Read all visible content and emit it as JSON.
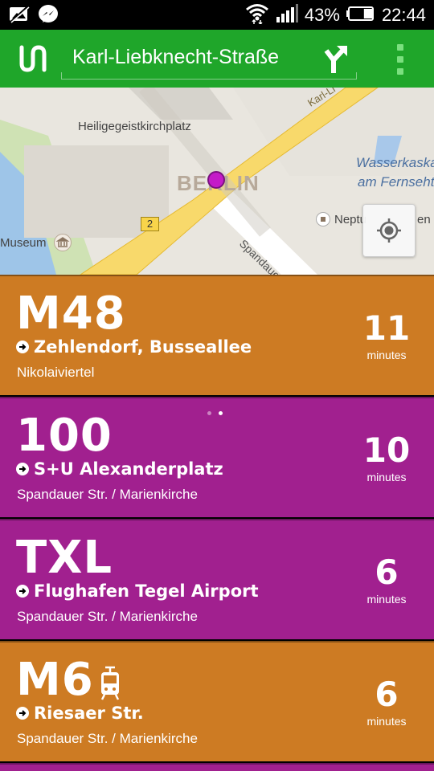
{
  "status_bar": {
    "icons_left": [
      "picture-notification-icon",
      "messenger-icon"
    ],
    "wifi_icon": "wifi-icon",
    "signal_icon": "signal-icon",
    "battery_percent": "43%",
    "battery_level": 0.43,
    "time": "22:44"
  },
  "app_bar": {
    "logo_icon": "app-logo-icon",
    "stop_name": "Karl-Liebknecht-Straße",
    "route_icon": "directions-icon",
    "menu_icon": "overflow-menu-icon",
    "color": "#1fa62a"
  },
  "map": {
    "labels": {
      "square": "Heiligegeistkirchplatz",
      "city": "BERLIN",
      "water": "Wasserkaska",
      "water2": "am Fernseht",
      "street": "Spandauer S",
      "street_top": "Karl-Li",
      "museum": "Museum",
      "poi": "Neptu",
      "poi2": "en",
      "road_number": "2"
    },
    "locate_icon": "my-location-icon"
  },
  "departures": [
    {
      "line": "M48",
      "destination": "Zehlendorf, Busseallee",
      "stop": "Nikolaiviertel",
      "minutes": "11",
      "unit": "minutes",
      "color": "#cd7b23",
      "tram": false
    },
    {
      "line": "100",
      "destination": "S+U Alexanderplatz",
      "stop": "Spandauer Str. / Marienkirche",
      "minutes": "10",
      "unit": "minutes",
      "color": "#a1208f",
      "tram": false
    },
    {
      "line": "TXL",
      "destination": "Flughafen Tegel Airport",
      "stop": "Spandauer Str. / Marienkirche",
      "minutes": "6",
      "unit": "minutes",
      "color": "#a1208f",
      "tram": false
    },
    {
      "line": "M6",
      "destination": "Riesaer Str.",
      "stop": "Spandauer Str. / Marienkirche",
      "minutes": "6",
      "unit": "minutes",
      "color": "#cd7b23",
      "tram": true
    }
  ],
  "pager": {
    "pages": 2,
    "active_index": 1
  }
}
